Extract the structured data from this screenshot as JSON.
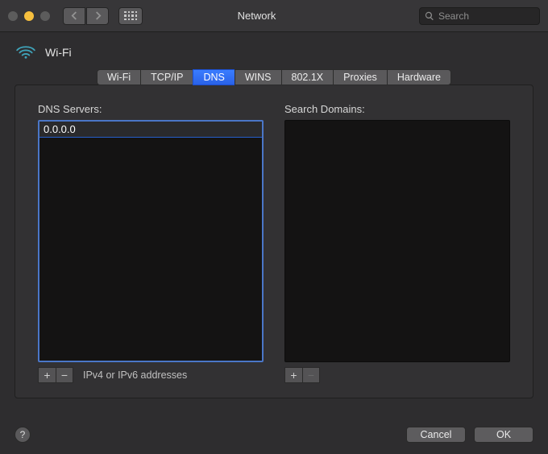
{
  "window": {
    "title": "Network"
  },
  "search": {
    "placeholder": "Search"
  },
  "interface": {
    "name": "Wi-Fi"
  },
  "tabs": [
    {
      "label": "Wi-Fi",
      "active": false
    },
    {
      "label": "TCP/IP",
      "active": false
    },
    {
      "label": "DNS",
      "active": true
    },
    {
      "label": "WINS",
      "active": false
    },
    {
      "label": "802.1X",
      "active": false
    },
    {
      "label": "Proxies",
      "active": false
    },
    {
      "label": "Hardware",
      "active": false
    }
  ],
  "dns": {
    "servers_label": "DNS Servers:",
    "servers": [
      {
        "value": "0.0.0.0",
        "editing": true
      }
    ],
    "hint": "IPv4 or IPv6 addresses",
    "domains_label": "Search Domains:",
    "domains": []
  },
  "buttons": {
    "add": "+",
    "remove": "−",
    "help": "?",
    "cancel": "Cancel",
    "ok": "OK"
  }
}
